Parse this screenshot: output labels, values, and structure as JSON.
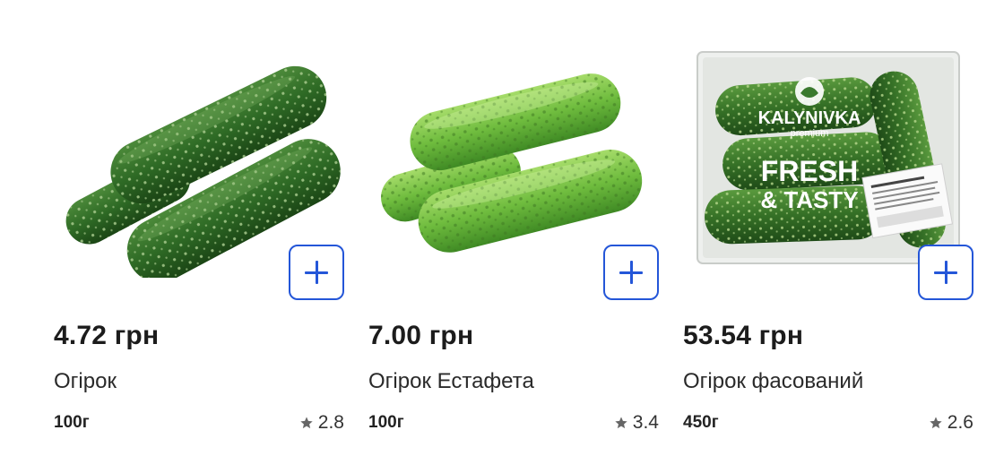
{
  "products": [
    {
      "price": "4.72 грн",
      "name": "Огірок",
      "weight": "100г",
      "rating": "2.8",
      "add_icon": "plus-icon",
      "image": "cucumbers-dark"
    },
    {
      "price": "7.00 грн",
      "name": "Огірок Естафета",
      "weight": "100г",
      "rating": "3.4",
      "add_icon": "plus-icon",
      "image": "cucumbers-light"
    },
    {
      "price": "53.54 грн",
      "name": "Огірок фасований",
      "weight": "450г",
      "rating": "2.6",
      "add_icon": "plus-icon",
      "image": "cucumbers-packaged",
      "package_text": {
        "brand": "KALYNIVKA",
        "brand_sub": "premium",
        "slogan_1": "FRESH",
        "slogan_2": "& TASTY"
      }
    }
  ],
  "colors": {
    "accent": "#2456d8",
    "star": "#666666"
  }
}
